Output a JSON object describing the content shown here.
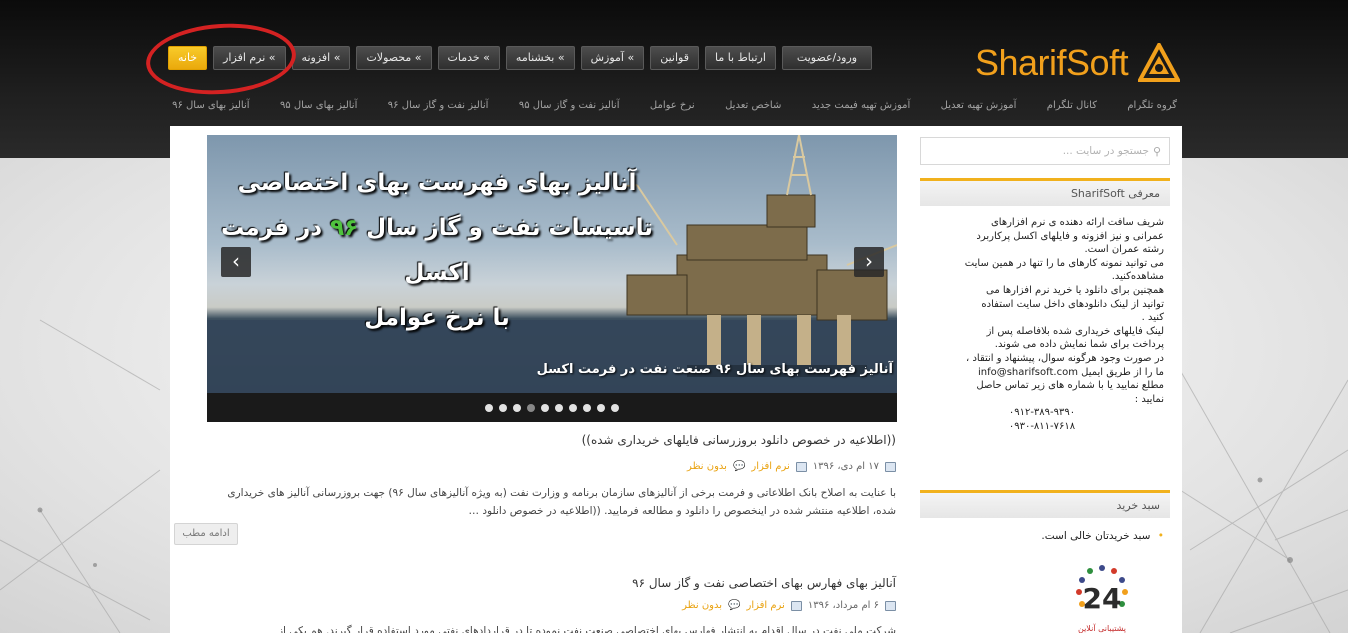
{
  "brand": {
    "name": "SharifSoft"
  },
  "menu": [
    {
      "label": "خانه",
      "active": true
    },
    {
      "label": "» نرم افزار"
    },
    {
      "label": "» افزونه"
    },
    {
      "label": "» محصولات"
    },
    {
      "label": "» خدمات"
    },
    {
      "label": "» بخشنامه"
    },
    {
      "label": "» آموزش"
    },
    {
      "label": "قوانین"
    },
    {
      "label": "ارتباط با ما"
    },
    {
      "label": "ورود/عضویت"
    }
  ],
  "submenu": [
    "آنالیز بهای سال ۹۶",
    "آنالیز بهای سال ۹۵",
    "آنالیز نفت و گاز سال ۹۶",
    "آنالیز نفت و گاز سال ۹۵",
    "نرخ عوامل",
    "شاخص تعدیل",
    "آموزش تهیه فیمت جدید",
    "آموزش تهیه تعدیل",
    "کانال تلگرام",
    "گروه تلگرام"
  ],
  "slider": {
    "title_line1": "آنالیز بهای فهرست بهای اختصاصی",
    "title_line2_a": "تاسیسات نفت و گاز سال",
    "title_line2_b": "۹۶",
    "title_line2_c": "در فرمت اکسل",
    "title_line3": "با نرخ عوامل",
    "caption": "آنالیز فهرست بهای سال ۹۶ صنعت نفت در فرمت اکسل",
    "dot_count": 10,
    "current_dot": 3
  },
  "posts": [
    {
      "title": "((اطلاعیه در خصوص دانلود بروزرسانی فایلهای خریداری شده))",
      "date": "۱۷ ام دی، ۱۳۹۶",
      "category": "نرم افزار",
      "comments": "بدون نظر",
      "excerpt_line1": "با عنایت به اصلاح بانک اطلاعاتی و فرمت برخی از آنالیزهای سازمان برنامه و وزارت نفت (به ویژه آنالیزهای سال ۹۶) جهت بروزرسانی آنالیز های خریداری",
      "excerpt_line2": "شده، اطلاعیه منتشر شده در اینخصوص را دانلود و مطالعه فرمایید. ((اطلاعیه در خصوص دانلود …",
      "more": "ادامه مطب"
    },
    {
      "title": "آنالیز بهای فهارس بهای اختصاصی نفت و گاز سال ۹۶",
      "date": "۶ ام مرداد، ۱۳۹۶",
      "category": "نرم افزار",
      "comments": "بدون نظر",
      "excerpt_line1": "شرکت ملی نفت در سال اقدام به انتشار فهارس بهای اختصاصی صنعت نفت نموده تا در قراردادهای نفتی مورد استفاده قرار گیرند. هم یکی از"
    }
  ],
  "sidebar": {
    "search_placeholder": "جستجو در سایت ...",
    "about_title": "معرفی SharifSoft",
    "about_lines": [
      "شریف سافت ارائه دهنده ی نرم افزارهای",
      "عمرانی و نیز افزونه و فایلهای اکسل پرکاربرد",
      "رشته عمران است.",
      "می توانید نمونه کارهای ما را تنها در همین سایت",
      "مشاهده‌کنید.",
      "همچنین برای دانلود یا خرید نرم افزارها می",
      "توانید از لینک دانلودهای داخل سایت استفاده",
      "کنید .",
      "لینک فایلهای خریداری شده بلافاصله پس از",
      "پرداخت برای شما نمایش داده می شوند.",
      "در صورت وجود هرگونه سوال، پیشنهاد و انتقاد ،",
      "ما را از طریق ایمیل info@sharifsoft.com",
      "مطلع نمایید یا با شماره های زیر تماس حاصل",
      "نمایید :"
    ],
    "phones": [
      "۰۹۱۲-۳۸۹-۹۳۹۰",
      "۰۹۳۰-۸۱۱-۷۶۱۸"
    ],
    "cart_title": "سبد خرید",
    "cart_empty": "سبد خریدتان خالی است.",
    "badge_number": "24",
    "badge_text": "پشتیبانی آنلاین"
  },
  "colors": {
    "accent": "#f1a01c",
    "highlight": "#4fc23e",
    "annotation": "#d42222"
  }
}
